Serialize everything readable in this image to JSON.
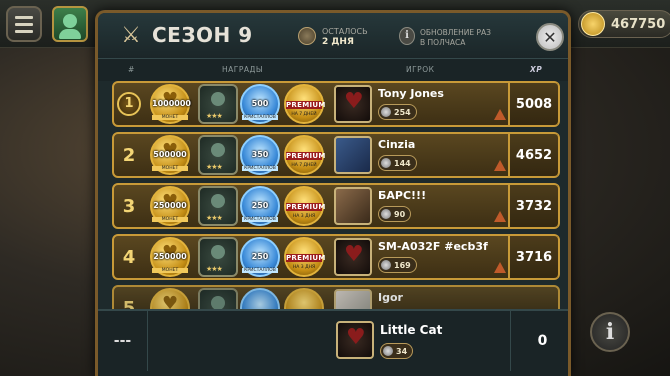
{
  "top_bar": {
    "currency_value": "467750"
  },
  "header": {
    "title": "СЕЗОН 9",
    "timer_label": "ОСТАЛОСЬ",
    "timer_value": "2 ДНЯ",
    "update_line1": "ОБНОВЛЕНИЕ РАЗ",
    "update_line2": "В ПОЛЧАСА"
  },
  "columns": {
    "rank": "#",
    "rewards": "НАГРАДЫ",
    "player": "ИГРОК",
    "xp": "XP"
  },
  "rows": [
    {
      "rank": "1",
      "coins": "1000000",
      "coins_sub": "МОНЕТ",
      "crystals": "500",
      "crystals_sub": "КРИСТАЛЛОВ",
      "premium": "PREMIUM",
      "premium_sub": "НА 7 ДНЕЙ",
      "name": "Tony Jones",
      "level": "254",
      "xp": "5008"
    },
    {
      "rank": "2",
      "coins": "500000",
      "coins_sub": "МОНЕТ",
      "crystals": "350",
      "crystals_sub": "КРИСТАЛЛОВ",
      "premium": "PREMIUM",
      "premium_sub": "НА 7 ДНЕЙ",
      "name": "Cinzia",
      "level": "144",
      "xp": "4652"
    },
    {
      "rank": "3",
      "coins": "250000",
      "coins_sub": "МОНЕТ",
      "crystals": "250",
      "crystals_sub": "КРИСТАЛЛОВ",
      "premium": "PREMIUM",
      "premium_sub": "НА 3 ДНЯ",
      "name": "БАРС!!!",
      "level": "90",
      "xp": "3732"
    },
    {
      "rank": "4",
      "coins": "250000",
      "coins_sub": "МОНЕТ",
      "crystals": "250",
      "crystals_sub": "КРИСТАЛЛОВ",
      "premium": "PREMIUM",
      "premium_sub": "НА 3 ДНЯ",
      "name": "SM-A032F #ecb3f",
      "level": "169",
      "xp": "3716"
    },
    {
      "rank": "5",
      "name": "Igor"
    }
  ],
  "my_row": {
    "rank": "---",
    "name": "Little Cat",
    "level": "34",
    "xp": "0"
  }
}
